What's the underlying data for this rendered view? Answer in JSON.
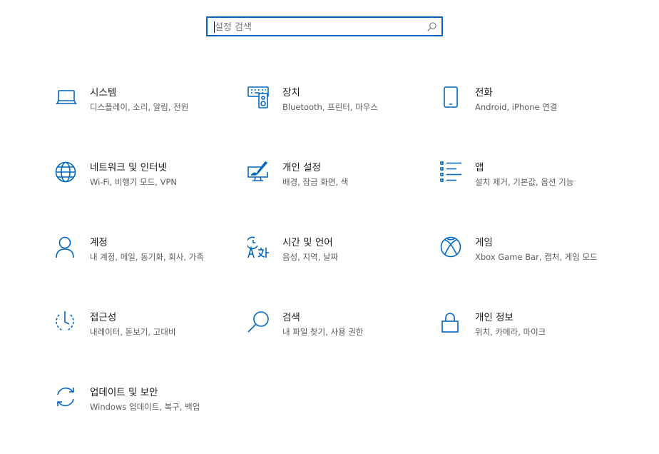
{
  "search": {
    "placeholder": "설정 검색"
  },
  "tiles": [
    {
      "title": "시스템",
      "desc": "디스플레이, 소리, 알림, 전원",
      "icon": "laptop-icon"
    },
    {
      "title": "장치",
      "desc": "Bluetooth, 프린터, 마우스",
      "icon": "devices-icon"
    },
    {
      "title": "전화",
      "desc": "Android, iPhone 연결",
      "icon": "phone-icon"
    },
    {
      "title": "네트워크 및 인터넷",
      "desc": "Wi-Fi, 비행기 모드, VPN",
      "icon": "globe-icon"
    },
    {
      "title": "개인 설정",
      "desc": "배경, 잠금 화면, 색",
      "icon": "personalization-icon"
    },
    {
      "title": "앱",
      "desc": "설치 제거, 기본값, 옵션 기능",
      "icon": "apps-list-icon"
    },
    {
      "title": "계정",
      "desc": "내 계정, 메일, 동기화, 회사, 가족",
      "icon": "person-icon"
    },
    {
      "title": "시간 및 언어",
      "desc": "음성, 지역, 날짜",
      "icon": "time-language-icon"
    },
    {
      "title": "게임",
      "desc": "Xbox Game Bar, 캡처, 게임 모드",
      "icon": "xbox-icon"
    },
    {
      "title": "접근성",
      "desc": "내레이터, 돋보기, 고대비",
      "icon": "ease-of-access-icon"
    },
    {
      "title": "검색",
      "desc": "내 파일 찾기, 사용 권한",
      "icon": "search-magnifier-icon"
    },
    {
      "title": "개인 정보",
      "desc": "위치, 카메라, 마이크",
      "icon": "lock-icon"
    },
    {
      "title": "업데이트 및 보안",
      "desc": "Windows 업데이트, 복구, 백업",
      "icon": "sync-icon"
    }
  ],
  "colors": {
    "accent": "#0067c0",
    "title": "#1a1a1a",
    "desc": "#5d5d5d"
  }
}
